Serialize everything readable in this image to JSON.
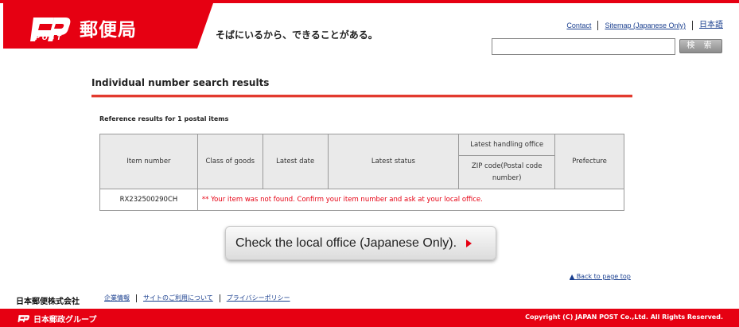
{
  "header": {
    "logo_post": "POST",
    "logo_name": "郵便局",
    "tagline": "そばにいるから、できることがある。",
    "links": [
      "Contact",
      "Sitemap (Japanese Only)",
      "日本語"
    ],
    "search_placeholder": "",
    "search_button": "検 索"
  },
  "main": {
    "title": "Individual number search results",
    "reference_text": "Reference results for 1 postal items",
    "table": {
      "headers": {
        "item_number": "Item number",
        "class_of_goods": "Class of goods",
        "latest_date": "Latest date",
        "latest_status": "Latest status",
        "latest_office": "Latest handling office",
        "zip_code": "ZIP code(Postal code number)",
        "prefecture": "Prefecture"
      },
      "rows": [
        {
          "item_number": "RX232500290CH",
          "message": "** Your item was not found. Confirm your item number and ask at your local office."
        }
      ]
    },
    "check_button": "Check the local office (Japanese Only).",
    "back_to_top": "▲ Back to page top"
  },
  "footer": {
    "company": "日本郵便株式会社",
    "links": [
      "企業情報",
      "サイトのご利用について",
      "プライバシーポリシー"
    ],
    "group_logo": "日本郵政グループ",
    "copyright": "Copyright (C) JAPAN POST Co.,Ltd.  All Rights Reserved."
  },
  "colors": {
    "brand_red": "#e60012",
    "link_blue": "#1a3f8f"
  }
}
